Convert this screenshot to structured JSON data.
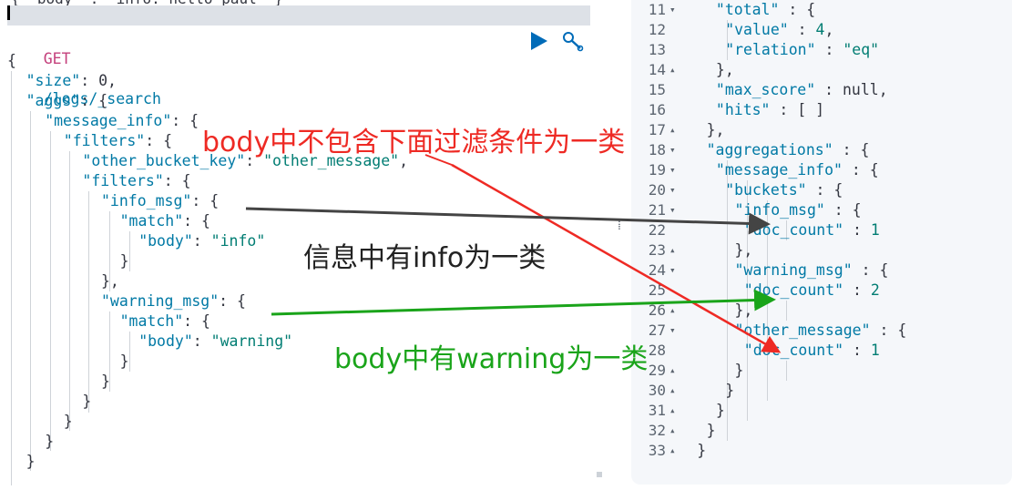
{
  "request": {
    "previous_doc_partial": "{ \"body\" : \"info: hello paul\" }",
    "method": "GET",
    "path": "/logs/_search",
    "run_icon": "play-icon",
    "settings_icon": "wrench-icon",
    "lines": [
      [
        [
          "{",
          "p"
        ]
      ],
      [
        [
          "\"size\"",
          "k"
        ],
        [
          ": ",
          "p"
        ],
        [
          "0",
          "p"
        ],
        [
          ",",
          "p"
        ]
      ],
      [
        [
          "\"aggs\"",
          "k"
        ],
        [
          ": {",
          "p"
        ]
      ],
      [
        [
          "\"message_info\"",
          "k"
        ],
        [
          ": {",
          "p"
        ]
      ],
      [
        [
          "\"filters\"",
          "k"
        ],
        [
          ": {",
          "p"
        ]
      ],
      [
        [
          "\"other_bucket_key\"",
          "k"
        ],
        [
          ": ",
          "p"
        ],
        [
          "\"other_message\"",
          "s"
        ],
        [
          ",",
          "p"
        ]
      ],
      [
        [
          "\"filters\"",
          "k"
        ],
        [
          ": {",
          "p"
        ]
      ],
      [
        [
          "\"info_msg\"",
          "k"
        ],
        [
          ": {",
          "p"
        ]
      ],
      [
        [
          "\"match\"",
          "k"
        ],
        [
          ": {",
          "p"
        ]
      ],
      [
        [
          "\"body\"",
          "k"
        ],
        [
          ": ",
          "p"
        ],
        [
          "\"info\"",
          "s"
        ]
      ],
      [
        [
          "}",
          "p"
        ]
      ],
      [
        [
          "},",
          "p"
        ]
      ],
      [
        [
          "\"warning_msg\"",
          "k"
        ],
        [
          ": {",
          "p"
        ]
      ],
      [
        [
          "\"match\"",
          "k"
        ],
        [
          ": {",
          "p"
        ]
      ],
      [
        [
          "\"body\"",
          "k"
        ],
        [
          ": ",
          "p"
        ],
        [
          "\"warning\"",
          "s"
        ]
      ],
      [
        [
          "}",
          "p"
        ]
      ],
      [
        [
          "}",
          "p"
        ]
      ],
      [
        [
          "}",
          "p"
        ]
      ],
      [
        [
          "}",
          "p"
        ]
      ],
      [
        [
          "}",
          "p"
        ]
      ],
      [
        [
          "}",
          "p"
        ]
      ]
    ]
  },
  "response": {
    "lines": [
      {
        "n": "11",
        "f": "▾",
        "t": [
          [
            "\"total\"",
            "k"
          ],
          [
            " : {",
            "p"
          ]
        ]
      },
      {
        "n": "12",
        "f": "",
        "t": [
          [
            "\"value\"",
            "k"
          ],
          [
            " : ",
            "p"
          ],
          [
            "4",
            "s"
          ],
          [
            ",",
            "p"
          ]
        ]
      },
      {
        "n": "13",
        "f": "",
        "t": [
          [
            "\"relation\"",
            "k"
          ],
          [
            " : ",
            "p"
          ],
          [
            "\"eq\"",
            "s"
          ]
        ]
      },
      {
        "n": "14",
        "f": "▴",
        "t": [
          [
            "},",
            "p"
          ]
        ]
      },
      {
        "n": "15",
        "f": "",
        "t": [
          [
            "\"max_score\"",
            "k"
          ],
          [
            " : ",
            "p"
          ],
          [
            "null",
            "p"
          ],
          [
            ",",
            "p"
          ]
        ]
      },
      {
        "n": "16",
        "f": "",
        "t": [
          [
            "\"hits\"",
            "k"
          ],
          [
            " : [ ]",
            "p"
          ]
        ]
      },
      {
        "n": "17",
        "f": "▴",
        "t": [
          [
            "},",
            "p"
          ]
        ]
      },
      {
        "n": "18",
        "f": "▾",
        "t": [
          [
            "\"aggregations\"",
            "k"
          ],
          [
            " : {",
            "p"
          ]
        ]
      },
      {
        "n": "19",
        "f": "▾",
        "t": [
          [
            "\"message_info\"",
            "k"
          ],
          [
            " : {",
            "p"
          ]
        ]
      },
      {
        "n": "20",
        "f": "▾",
        "t": [
          [
            "\"buckets\"",
            "k"
          ],
          [
            " : {",
            "p"
          ]
        ]
      },
      {
        "n": "21",
        "f": "▾",
        "t": [
          [
            "\"info_msg\"",
            "k"
          ],
          [
            " : {",
            "p"
          ]
        ]
      },
      {
        "n": "22",
        "f": "",
        "t": [
          [
            "\"doc_count\"",
            "k"
          ],
          [
            " : ",
            "p"
          ],
          [
            "1",
            "s"
          ]
        ]
      },
      {
        "n": "23",
        "f": "▴",
        "t": [
          [
            "},",
            "p"
          ]
        ]
      },
      {
        "n": "24",
        "f": "▾",
        "t": [
          [
            "\"warning_msg\"",
            "k"
          ],
          [
            " : {",
            "p"
          ]
        ]
      },
      {
        "n": "25",
        "f": "",
        "t": [
          [
            "\"doc_count\"",
            "k"
          ],
          [
            " : ",
            "p"
          ],
          [
            "2",
            "s"
          ]
        ]
      },
      {
        "n": "26",
        "f": "▴",
        "t": [
          [
            "},",
            "p"
          ]
        ]
      },
      {
        "n": "27",
        "f": "▾",
        "t": [
          [
            "\"other_message\"",
            "k"
          ],
          [
            " : {",
            "p"
          ]
        ]
      },
      {
        "n": "28",
        "f": "",
        "t": [
          [
            "\"doc_count\"",
            "k"
          ],
          [
            " : ",
            "p"
          ],
          [
            "1",
            "s"
          ]
        ]
      },
      {
        "n": "29",
        "f": "▴",
        "t": [
          [
            "}",
            "p"
          ]
        ]
      },
      {
        "n": "30",
        "f": "▴",
        "t": [
          [
            "}",
            "p"
          ]
        ]
      },
      {
        "n": "31",
        "f": "▴",
        "t": [
          [
            "}",
            "p"
          ]
        ]
      },
      {
        "n": "32",
        "f": "▴",
        "t": [
          [
            "}",
            "p"
          ]
        ]
      },
      {
        "n": "33",
        "f": "▴",
        "t": [
          [
            "}",
            "p"
          ]
        ]
      }
    ]
  },
  "annotations": {
    "red": "body中不包含下面过滤条件为一类",
    "black": "信息中有info为一类",
    "green": "body中有warning为一类"
  },
  "colors": {
    "key": "#0079a5",
    "string": "#017d73",
    "method": "#c4407c",
    "arrow_red": "#ee2a24",
    "arrow_black": "#444444",
    "arrow_green": "#1aa41a"
  }
}
